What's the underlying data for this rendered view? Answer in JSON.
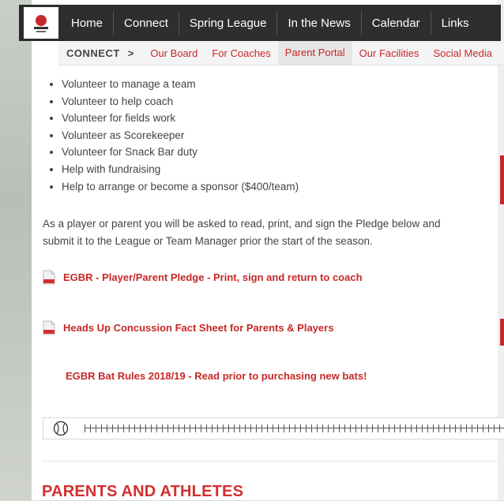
{
  "nav": {
    "items": [
      "Home",
      "Connect",
      "Spring League",
      "In the News",
      "Calendar",
      "Links"
    ]
  },
  "subnav": {
    "heading": "CONNECT",
    "items": [
      "Our Board",
      "For Coaches",
      "Parent Portal",
      "Our Facilities",
      "Social Media"
    ],
    "active": "Parent Portal"
  },
  "volunteer_list": [
    "Volunteer to manage a team",
    "Volunteer to help coach",
    "Volunteer for fields work",
    "Volunteer as Scorekeeper",
    "Volunteer for Snack Bar duty",
    "Help with fundraising",
    "Help to arrange or become a sponsor ($400/team)"
  ],
  "pledge_paragraph": "As a player or parent you will be asked to read, print, and sign the Pledge below and submit it to the League or Team Manager prior the start of the season.",
  "documents": {
    "pledge": "EGBR - Player/Parent Pledge - Print, sign and return to coach",
    "concussion": "Heads Up Concussion Fact Sheet for Parents & Players"
  },
  "bat_rules": "EGBR Bat Rules 2018/19 - Read prior to purchasing new bats!",
  "section_heading": "PARENTS AND ATHLETES",
  "colors": {
    "accent": "#c62828",
    "nav_bg": "#1e1e1e"
  },
  "icons": {
    "pdf": "pdf-icon",
    "baseball": "baseball-icon",
    "logo": "league-logo"
  }
}
